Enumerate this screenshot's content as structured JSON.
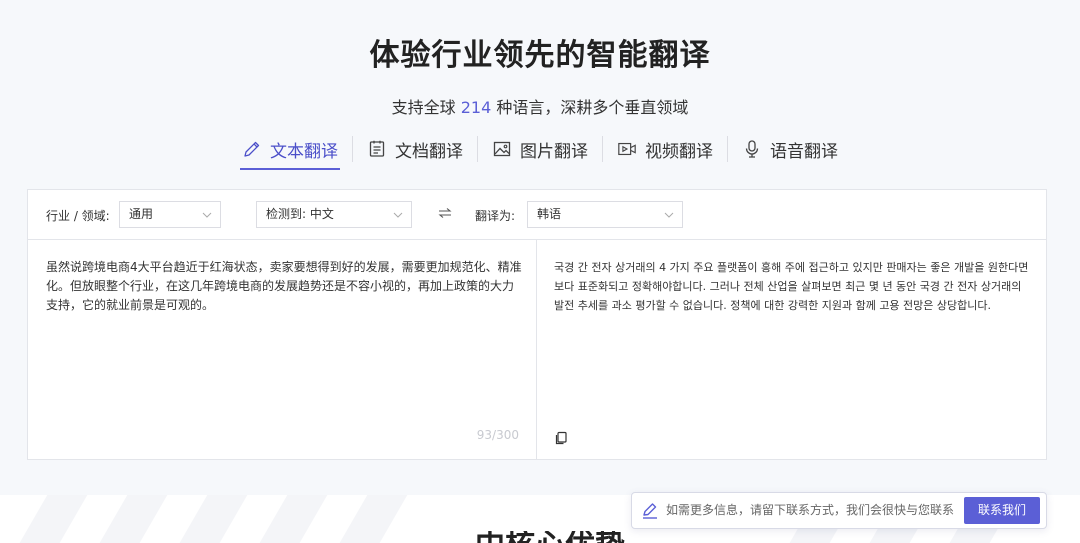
{
  "header": {
    "title": "体验行业领先的智能翻译",
    "subtitle_before": "支持全球 ",
    "subtitle_num": "214",
    "subtitle_after": " 种语言，深耕多个垂直领域"
  },
  "tabs": [
    {
      "label": "文本翻译",
      "icon": "pencil-icon",
      "active": true
    },
    {
      "label": "文档翻译",
      "icon": "document-icon",
      "active": false
    },
    {
      "label": "图片翻译",
      "icon": "image-icon",
      "active": false
    },
    {
      "label": "视频翻译",
      "icon": "video-icon",
      "active": false
    },
    {
      "label": "语音翻译",
      "icon": "microphone-icon",
      "active": false
    }
  ],
  "toolbar": {
    "domain_label": "行业 / 领域:",
    "domain_value": "通用",
    "detect_value": "检测到: 中文",
    "swap_icon": "swap-icon",
    "target_label": "翻译为:",
    "target_value": "韩语"
  },
  "source": {
    "text": "虽然说跨境电商4大平台趋近于红海状态，卖家要想得到好的发展，需要更加规范化、精准化。但放眼整个行业，在这几年跨境电商的发展趋势还是不容小视的，再加上政策的大力支持，它的就业前景是可观的。",
    "counter": "93/300"
  },
  "result": {
    "text": "국경 간 전자 상거래의 4 가지 주요 플랫폼이 홍해 주에 접근하고 있지만 판매자는 좋은 개발을 원한다면보다 표준화되고 정확해야합니다. 그러나 전체 산업을 살펴보면 최근 몇 년 동안 국경 간 전자 상거래의 발전 추세를 과소 평가할 수 없습니다. 정책에 대한 강력한 지원과 함께 고용 전망은 상당합니다.",
    "copy_icon": "copy-icon"
  },
  "contact": {
    "placeholder": "如需更多信息，请留下联系方式，我们会很快与您联系",
    "button": "联系我们"
  },
  "next_section": {
    "heading": "中核心优势"
  },
  "colors": {
    "accent": "#5b5fd6",
    "background": "#f6f8fb",
    "border": "#e3e5ea"
  }
}
